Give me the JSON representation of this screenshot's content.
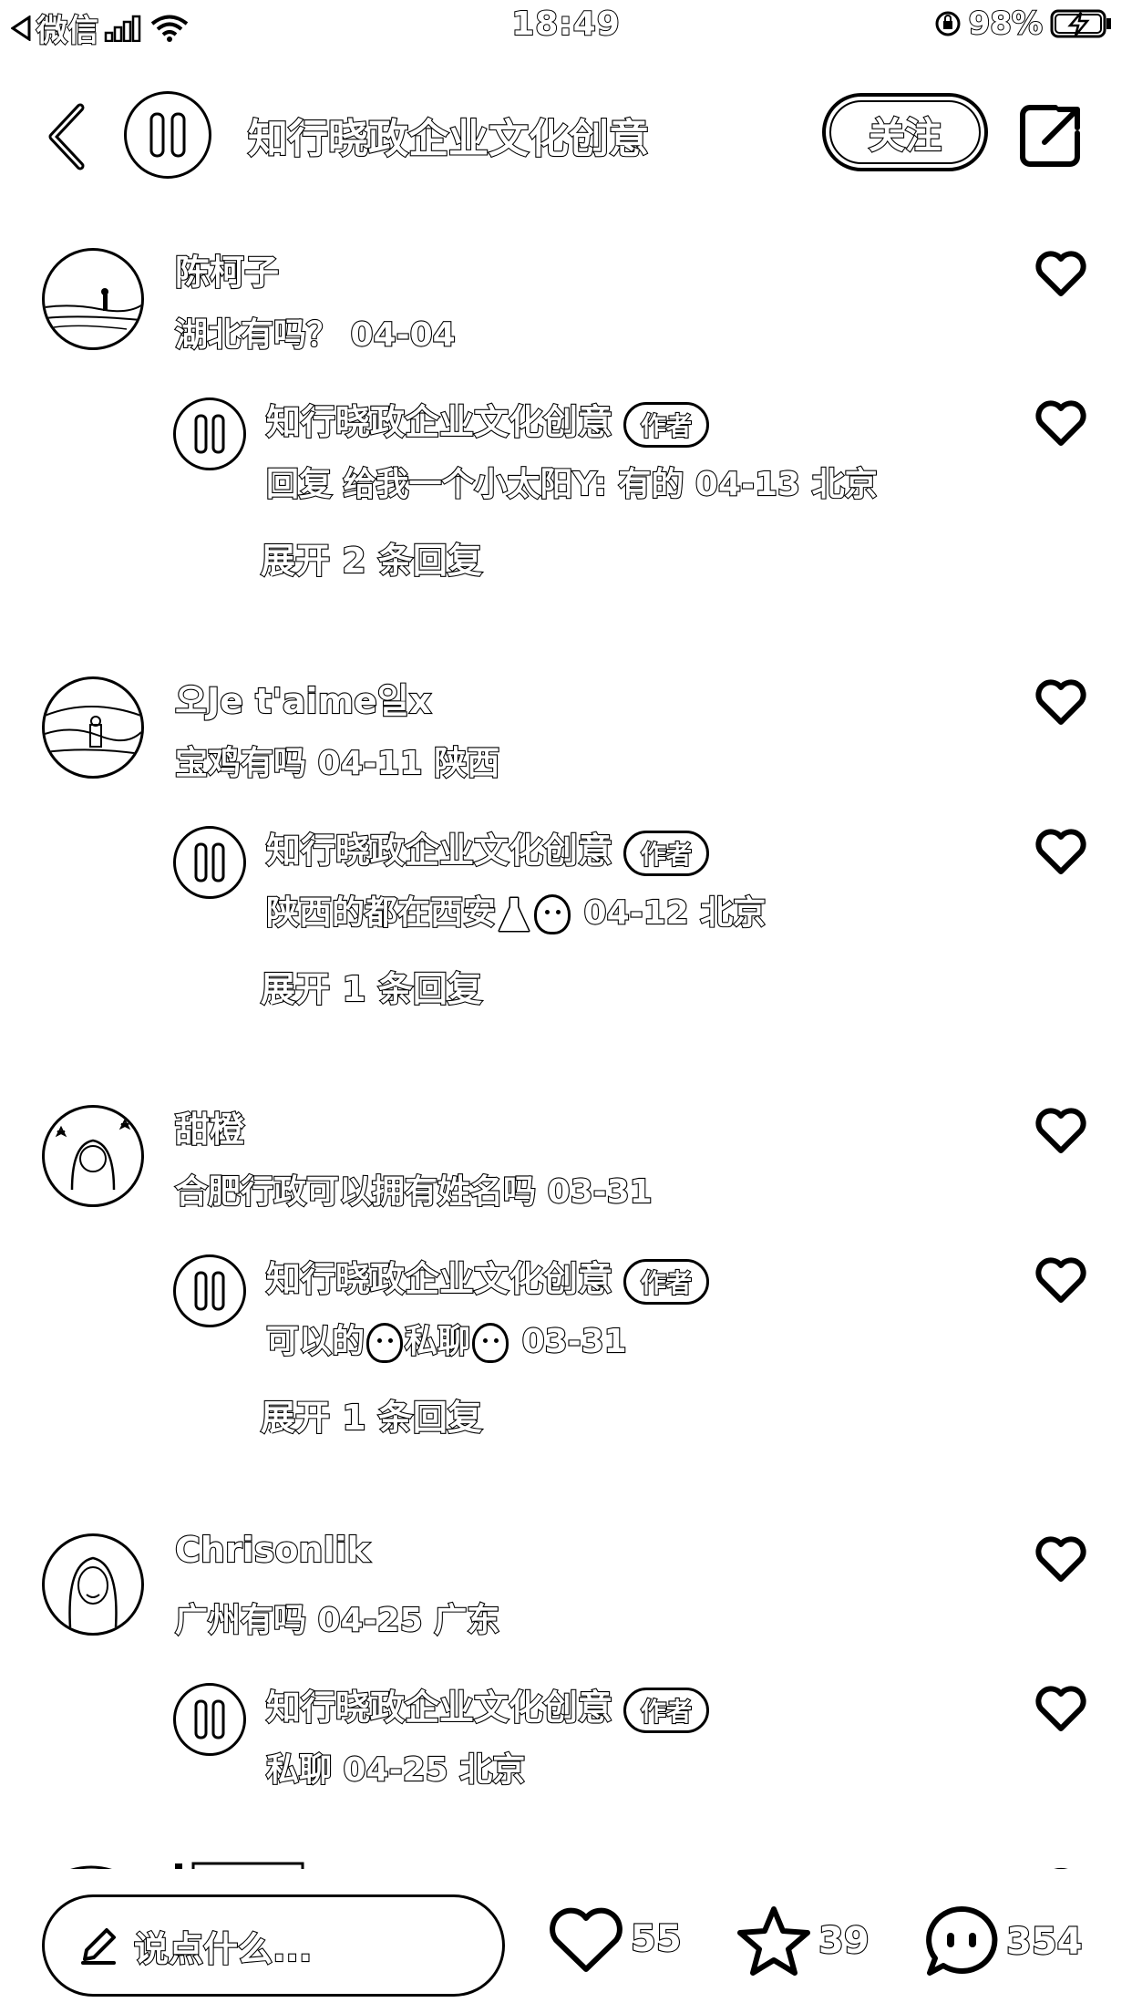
{
  "status_bar": {
    "back_app": "微信",
    "time": "18:49",
    "battery": "98%"
  },
  "nav": {
    "title": "知行晓政企业文化创意",
    "follow_label": "关注"
  },
  "comments": [
    {
      "name": "陈柯子",
      "text": "湖北有吗？  04-04",
      "reply": {
        "name": "知行晓政企业文化创意",
        "badge": "作者",
        "text": "回复 给我一个小太阳Y: 有的 04-13 北京"
      },
      "expand": "展开 2 条回复"
    },
    {
      "name": "오Je t'aime일x",
      "text": "宝鸡有吗 04-11 陕西",
      "reply": {
        "name": "知行晓政企业文化创意",
        "badge": "作者",
        "text_before": "陕西的都在西安",
        "text_after": " 04-12 北京"
      },
      "expand": "展开 1 条回复"
    },
    {
      "name": "甜橙",
      "text": "合肥行政可以拥有姓名吗 03-31",
      "reply": {
        "name": "知行晓政企业文化创意",
        "badge": "作者",
        "text_a": "可以的",
        "text_b": "私聊",
        "text_c": " 03-31"
      },
      "expand": "展开 1 条回复"
    },
    {
      "name": "Chrisonlik",
      "text": "广州有吗 04-25 广东",
      "reply": {
        "name": "知行晓政企业文化创意",
        "badge": "作者",
        "text": "私聊 04-25 北京"
      }
    }
  ],
  "bottom_bar": {
    "input_placeholder": "说点什么...",
    "likes": "55",
    "favorites": "39",
    "comments": "354"
  },
  "icons": {
    "back": "chevron-left-icon",
    "share": "share-icon",
    "like": "heart-icon",
    "favorite": "star-icon",
    "comment": "chat-bubble-icon",
    "edit": "pencil-icon"
  }
}
